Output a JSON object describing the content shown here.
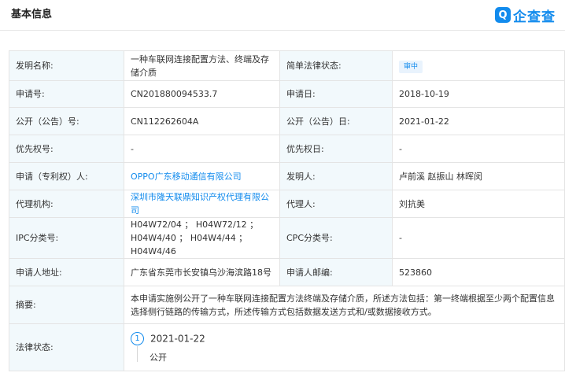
{
  "header": {
    "title": "基本信息",
    "logo_mark": "Q",
    "logo_text": "企查查"
  },
  "rows": {
    "invention_name_label": "发明名称:",
    "invention_name_value": "一种车联网连接配置方法、终端及存储介质",
    "legal_status_simple_label": "简单法律状态:",
    "legal_status_simple_value": "审中",
    "app_no_label": "申请号:",
    "app_no_value": "CN201880094533.7",
    "app_date_label": "申请日:",
    "app_date_value": "2018-10-19",
    "pub_no_label": "公开（公告）号:",
    "pub_no_value": "CN112262604A",
    "pub_date_label": "公开（公告）日:",
    "pub_date_value": "2021-01-22",
    "priority_no_label": "优先权号:",
    "priority_no_value": "-",
    "priority_date_label": "优先权日:",
    "priority_date_value": "-",
    "applicant_label": "申请（专利权）人:",
    "applicant_value": "OPPO广东移动通信有限公司",
    "inventor_label": "发明人:",
    "inventor_value": "卢前溪 赵振山 林晖闵",
    "agency_label": "代理机构:",
    "agency_value": "深圳市隆天联鼎知识产权代理有限公司",
    "agent_label": "代理人:",
    "agent_value": "刘抗美",
    "ipc_label": "IPC分类号:",
    "ipc_value": "H04W72/04 ； H04W72/12 ； H04W4/40 ； H04W4/44 ； H04W4/46",
    "cpc_label": "CPC分类号:",
    "cpc_value": "-",
    "address_label": "申请人地址:",
    "address_value": "广东省东莞市长安镇乌沙海滨路18号",
    "postcode_label": "申请人邮编:",
    "postcode_value": "523860",
    "abstract_label": "摘要:",
    "abstract_value": "本申请实施例公开了一种车联网连接配置方法终端及存储介质，所述方法包括：第一终端根据至少两个配置信息选择侧行链路的传输方式，所述传输方式包括数据发送方式和/或数据接收方式。",
    "legal_status_label": "法律状态:",
    "legal_status_index": "1",
    "legal_status_date": "2021-01-22",
    "legal_status_event": "公开"
  }
}
